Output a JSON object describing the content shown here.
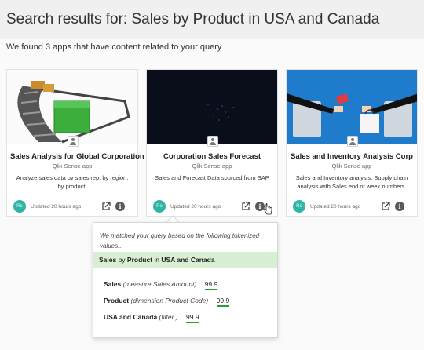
{
  "header": {
    "title": "Search results for: Sales by Product in USA and Canada"
  },
  "summary": "We found 3 apps that have content related to your query",
  "cards": [
    {
      "title": "Sales Analysis for Global Corporation",
      "type": "Qlik Sense app",
      "description": "Analyze sales data by sales rep, by region, by product.",
      "avatar": "Ro",
      "updated": "Updated 20 hours ago",
      "thumbnail_icon": "conveyor-boxes-image"
    },
    {
      "title": "Corporation Sales Forecast",
      "type": "Qlik Sense app",
      "description": "Sales and Forecast Data sourced from SAP",
      "avatar": "Ro",
      "updated": "Updated 20 hours ago",
      "thumbnail_icon": "night-map-image"
    },
    {
      "title": "Sales and Inventory Analysis Corp",
      "type": "Qlik Sense app",
      "description": "Sales and Inventory analysis. Supply chain analysis with Sales end of week numbers.",
      "avatar": "Ro",
      "updated": "Updated 20 hours ago",
      "thumbnail_icon": "online-shopping-image"
    }
  ],
  "popup": {
    "intro": "We matched your query based on the following tokenized values...",
    "query": {
      "t1": "Sales",
      "t2": " by ",
      "t3": "Product",
      "t4": " in ",
      "t5": "USA and Canada"
    },
    "matches": [
      {
        "keyword": "Sales",
        "hint": "(measure Sales Amount)",
        "score": "99.9"
      },
      {
        "keyword": "Product",
        "hint": "(dimension Product Code)",
        "score": "99.9"
      },
      {
        "keyword": "USA and Canada",
        "hint": "(filter )",
        "score": "99.9"
      }
    ]
  },
  "colors": {
    "avatar": "#2fb4a6",
    "highlight": "#d8efd3",
    "underline": "#2a9d3a",
    "header_bg": "#f0f0f0"
  }
}
